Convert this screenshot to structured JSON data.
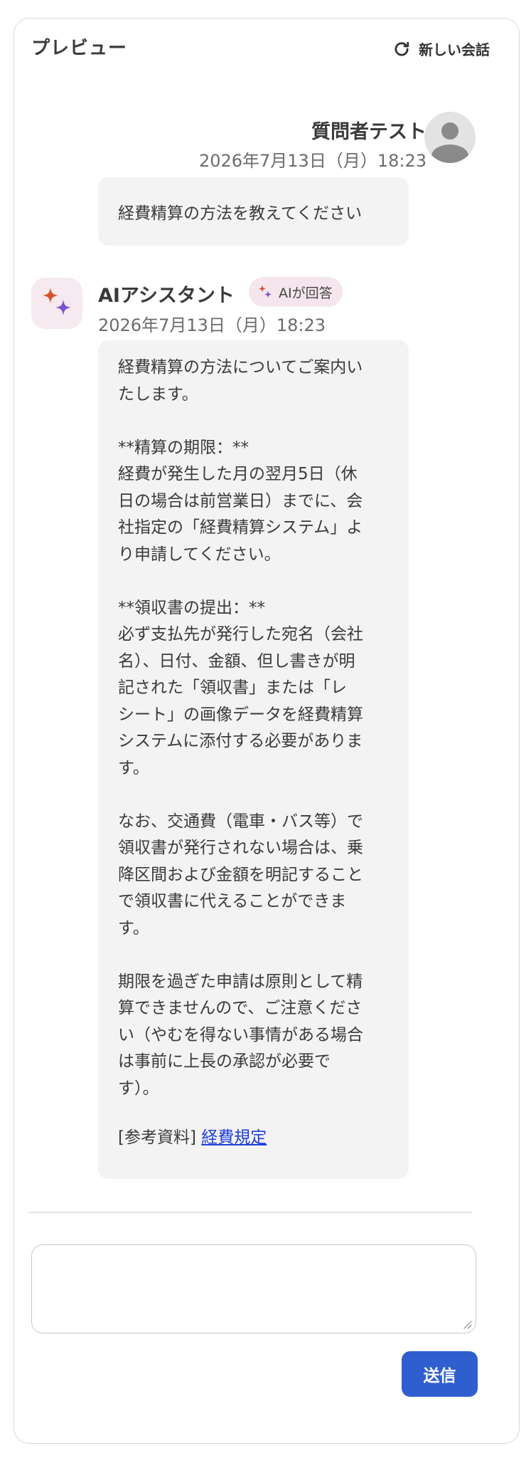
{
  "header": {
    "title": "プレビュー",
    "new_chat_label": "新しい会話",
    "new_chat_icon": "refresh-icon"
  },
  "user_message": {
    "name": "質問者テスト",
    "timestamp": "2026年7月13日（月）18:23",
    "text": "経費精算の方法を教えてください",
    "avatar_icon": "user-avatar-icon"
  },
  "ai_message": {
    "name": "AIアシスタント",
    "badge": "AIが回答",
    "badge_icon": "sparkle-icon",
    "timestamp": "2026年7月13日（月）18:23",
    "lines": {
      "p1": [
        "経費精算の方法についてご案内い",
        "たします。"
      ],
      "p2": [
        "**精算の期限：**",
        "経費が発生した月の翌月5日（休",
        "日の場合は前営業日）までに、会",
        "社指定の「経費精算システム」よ",
        "り申請してください。"
      ],
      "p3": [
        "**領収書の提出：**",
        "必ず支払先が発行した宛名（会社",
        "名）、日付、金額、但し書きが明",
        "記された「領収書」または「レ",
        "シート」の画像データを経費精算",
        "システムに添付する必要がありま",
        "す。"
      ],
      "p4": [
        "なお、交通費（電車・バス等）で",
        "領収書が発行されない場合は、乗",
        "降区間および金額を明記すること",
        "で領収書に代えることができま",
        "す。"
      ],
      "p5": [
        "期限を過ぎた申請は原則として精",
        "算できませんので、ご注意くださ",
        "い（やむを得ない事情がある場合",
        "は事前に上長の承認が必要で",
        "す）。"
      ]
    },
    "reference_prefix": "[参考資料]",
    "reference_link": "経費規定"
  },
  "composer": {
    "placeholder": "",
    "send_label": "送信"
  },
  "colors": {
    "accent": "#2f5fcf",
    "link": "#1f3fd8",
    "bubble": "#f4f3f4",
    "badge": "#f5e6ee",
    "sparkle_orange": "#d9532c",
    "sparkle_purple": "#7b4fd6"
  }
}
